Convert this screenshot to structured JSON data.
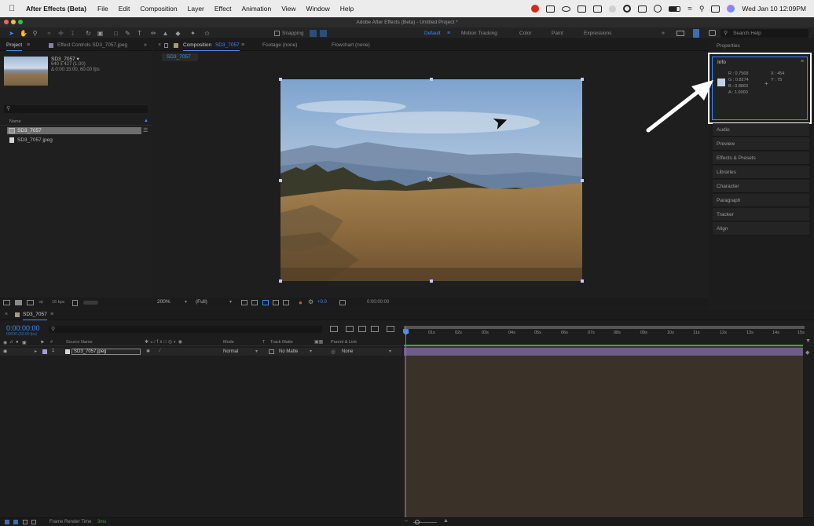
{
  "menubar": {
    "app_name": "After Effects (Beta)",
    "menus": [
      "File",
      "Edit",
      "Composition",
      "Layer",
      "Effect",
      "Animation",
      "View",
      "Window",
      "Help"
    ],
    "clock": "Wed Jan 10  12:09PM"
  },
  "window": {
    "title": "Adobe After Effects (Beta) - Untitled Project *"
  },
  "toolbar": {
    "snapping_label": "Snapping",
    "workspaces": [
      "Default",
      "Motion Tracking",
      "Color",
      "Paint",
      "Expressions"
    ],
    "search_placeholder": "Search Help"
  },
  "project_panel": {
    "tab_project": "Project",
    "tab_effect_controls": "Effect Controls SD3_7057.jpeg",
    "selected_item_name": "SD3_7057 ▾",
    "selected_item_dims": "640 x 427 (1.00)",
    "selected_item_duration": "Δ 0:00:15:00, 60.00 fps",
    "column_name": "Name",
    "items": [
      {
        "name": "SD3_7057"
      },
      {
        "name": "SD3_7057.jpeg"
      }
    ],
    "bpc": "16 bpc"
  },
  "composition_panel": {
    "tab_label": "Composition",
    "comp_name": "SD3_7057",
    "tab_footage": "Footage (none)",
    "tab_flowchart": "Flowchart (none)",
    "breadcrumb": "SD3_7057",
    "zoom": "200%",
    "resolution": "(Full)",
    "exposure": "+0.0",
    "timecode": "0:00:00:00"
  },
  "info_panel": {
    "properties_label": "Properties",
    "title": "Info",
    "r": "R :  0.7568",
    "g": "G :  0.8274",
    "b": "B :  0.8863",
    "a": "A :  1.0000",
    "x": "X : 454",
    "y": "Y : 75",
    "swatch_color": "#c1d3e2"
  },
  "right_panels": [
    "Audio",
    "Preview",
    "Effects & Presets",
    "Libraries",
    "Character",
    "Paragraph",
    "Tracker",
    "Align"
  ],
  "timeline": {
    "comp_tab": "SD3_7057",
    "timecode": "0:00:00:00",
    "sub_timecode": "00000 (60.00 fps)",
    "headers": {
      "hash": "#",
      "source_name": "Source Name",
      "mode": "Mode",
      "t": "T",
      "track_matte": "Track Matte",
      "parent_link": "Parent & Link"
    },
    "layer": {
      "index": "1",
      "name": "SD3_7057.jpeg",
      "mode": "Normal",
      "matte": "No Matte",
      "parent": "None"
    },
    "ticks": [
      "0s",
      "01s",
      "02s",
      "03s",
      "04s",
      "05s",
      "06s",
      "07s",
      "08s",
      "09s",
      "10s",
      "11s",
      "12s",
      "13s",
      "14s",
      "15s"
    ]
  },
  "status": {
    "label": "Frame Render Time",
    "value": "3ms"
  },
  "colors": {
    "accent": "#3b8bff",
    "highlight_border": "#ffffff",
    "layer_bar": "#6f5c8a"
  }
}
